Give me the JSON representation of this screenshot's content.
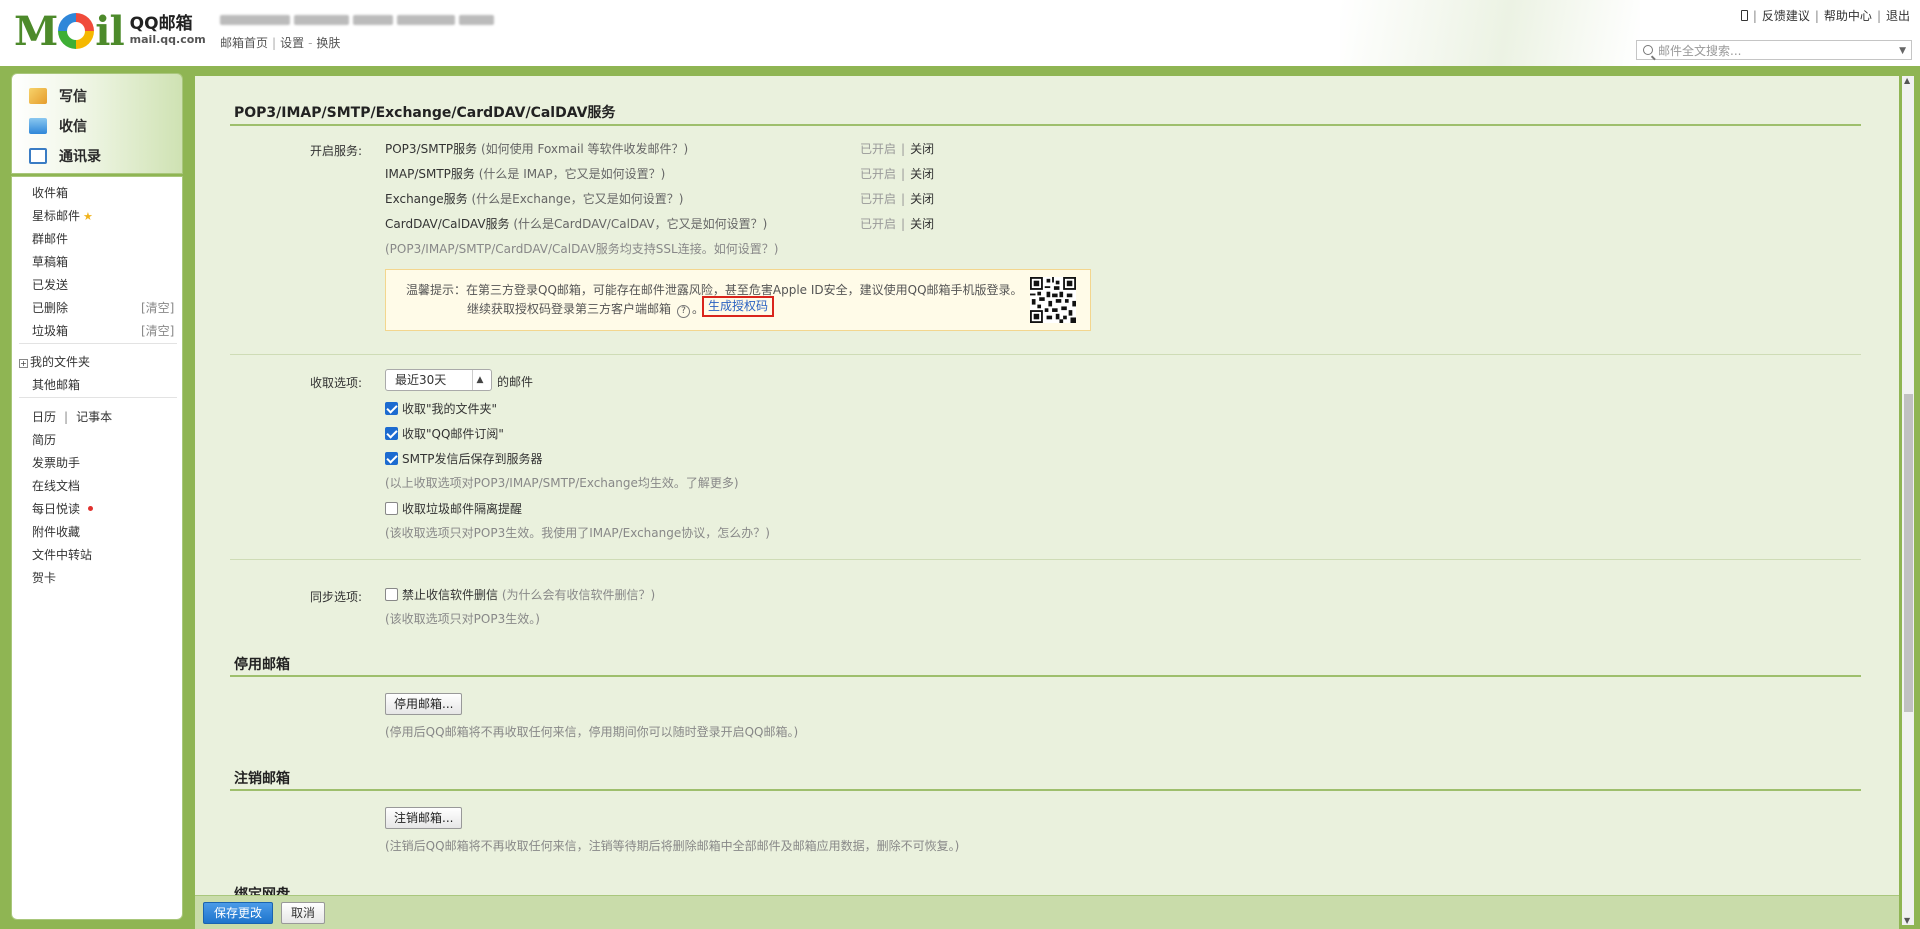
{
  "header": {
    "brand": "QQ邮箱",
    "domain": "mail.qq.com",
    "links": [
      "邮箱首页",
      "设置",
      "换肤"
    ],
    "top_links": [
      "反馈建议",
      "帮助中心",
      "退出"
    ],
    "search_placeholder": "邮件全文搜索..."
  },
  "sidebar": {
    "quick_actions": [
      "写信",
      "收信",
      "通讯录"
    ],
    "folders": [
      "收件箱",
      "星标邮件",
      "群邮件",
      "草稿箱",
      "已发送",
      "已删除",
      "垃圾箱"
    ],
    "clear_label": "[清空]",
    "my_folders": "我的文件夹",
    "other_mail": "其他邮箱",
    "apps": [
      "日历",
      "记事本",
      "简历",
      "发票助手",
      "在线文档",
      "每日悦读",
      "附件收藏",
      "文件中转站",
      "贺卡"
    ]
  },
  "services": {
    "title": "POP3/IMAP/SMTP/Exchange/CardDAV/CalDAV服务",
    "label": "开启服务:",
    "items": [
      {
        "name": "POP3/SMTP服务",
        "note": "(如何使用 Foxmail 等软件收发邮件？)"
      },
      {
        "name": "IMAP/SMTP服务",
        "note": "(什么是 IMAP，它又是如何设置？)"
      },
      {
        "name": "Exchange服务",
        "note": "(什么是Exchange，它又是如何设置？)"
      },
      {
        "name": "CardDAV/CalDAV服务",
        "note": "(什么是CardDAV/CalDAV，它又是如何设置？)"
      }
    ],
    "status_on": "已开启",
    "status_off": "关闭",
    "ssl_note": "(POP3/IMAP/SMTP/CardDAV/CalDAV服务均支持SSL连接。如何设置？)",
    "notice_line1": "温馨提示：在第三方登录QQ邮箱，可能存在邮件泄露风险，甚至危害Apple ID安全，建议使用QQ邮箱手机版登录。",
    "notice_line2": "继续获取授权码登录第三方客户端邮箱",
    "generate_code": "生成授权码"
  },
  "receive": {
    "label": "收取选项:",
    "range": "最近30天",
    "range_suffix": "的邮件",
    "options": [
      {
        "text": "收取\"我的文件夹\"",
        "checked": true
      },
      {
        "text": "收取\"QQ邮件订阅\"",
        "checked": true
      },
      {
        "text": "SMTP发信后保存到服务器",
        "checked": true
      }
    ],
    "note1": "(以上收取选项对POP3/IMAP/SMTP/Exchange均生效。了解更多)",
    "spam_option": "收取垃圾邮件隔离提醒",
    "note2": "(该收取选项只对POP3生效。我使用了IMAP/Exchange协议，怎么办？)"
  },
  "sync": {
    "label": "同步选项:",
    "option": "禁止收信软件删信",
    "option_note": "(为什么会有收信软件删信？)",
    "note": "(该收取选项只对POP3生效。)"
  },
  "disable": {
    "title": "停用邮箱",
    "button": "停用邮箱...",
    "note": "(停用后QQ邮箱将不再收取任何来信，停用期间你可以随时登录开启QQ邮箱。)"
  },
  "cancel_account": {
    "title": "注销邮箱",
    "button": "注销邮箱...",
    "note": "(注销后QQ邮箱将不再收取任何来信，注销等待期后将删除邮箱中全部邮件及邮箱应用数据，删除不可恢复。)"
  },
  "next_section_partial": "绑定网盘",
  "footer": {
    "save": "保存更改",
    "cancel": "取消"
  }
}
